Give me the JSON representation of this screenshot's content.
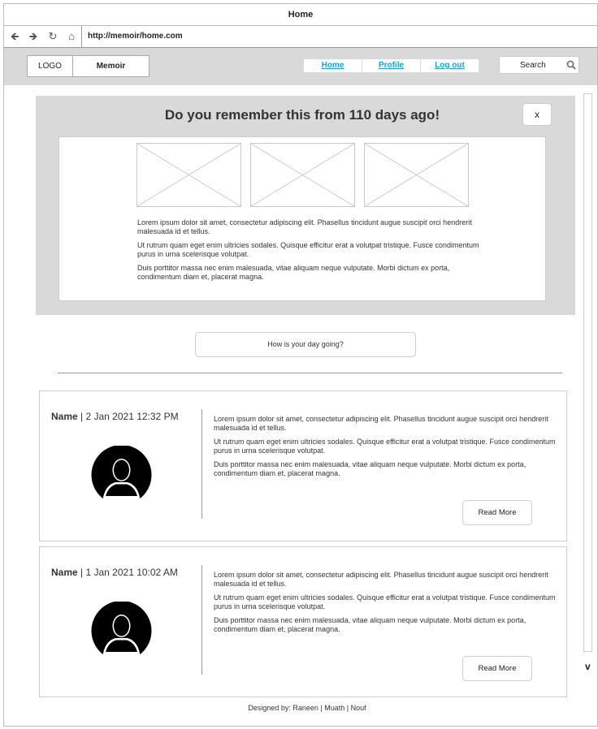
{
  "window": {
    "title": "Home"
  },
  "address": {
    "url": "http://memoir/home.com"
  },
  "header": {
    "logo": "LOGO",
    "brand": "Memoir",
    "nav": [
      {
        "label": "Home"
      },
      {
        "label": "Profile"
      },
      {
        "label": "Log out"
      }
    ],
    "search_label": "Search"
  },
  "memory": {
    "title": "Do you remember this from 110 days ago!",
    "close_label": "x",
    "paragraphs": [
      "Lorem ipsum dolor sit amet, consectetur adipiscing elit. Phasellus tincidunt augue suscipit orci hendrerit malesuada id et tellus.",
      "Ut rutrum quam eget enim ultricies sodales. Quisque efficitur erat a volutpat tristique. Fusce condimentum purus in urna scelerisque volutpat.",
      "Duis porttitor massa nec enim malesuada, vitae aliquam neque vulputate. Morbi dictum ex porta, condimentum diam et, placerat magna."
    ]
  },
  "prompt": {
    "label": "How is your day going?"
  },
  "posts": [
    {
      "name": "Name",
      "sep": " | ",
      "date": "2 Jan 2021 12:32 PM",
      "paragraphs": [
        "Lorem ipsum dolor sit amet, consectetur adipiscing elit. Phasellus tincidunt augue suscipit orci hendrerit malesuada id et tellus.",
        "Ut rutrum quam eget enim ultricies sodales. Quisque efficitur erat a volutpat tristique. Fusce condimentum purus in urna scelerisque volutpat.",
        "Duis porttitor massa nec enim malesuada, vitae aliquam neque vulputate. Morbi dictum ex porta, condimentum diam et, placerat magna."
      ],
      "read_more": "Read More"
    },
    {
      "name": "Name",
      "sep": " | ",
      "date": "1 Jan 2021 10:02 AM",
      "paragraphs": [
        "Lorem ipsum dolor sit amet, consectetur adipiscing elit. Phasellus tincidunt augue suscipit orci hendrerit malesuada id et tellus.",
        "Ut rutrum quam eget enim ultricies sodales. Quisque efficitur erat a volutpat tristique. Fusce condimentum purus in urna scelerisque volutpat.",
        "Duis porttitor massa nec enim malesuada, vitae aliquam neque vulputate. Morbi dictum ex porta, condimentum diam et, placerat magna."
      ],
      "read_more": "Read More"
    }
  ],
  "footer": {
    "text": "Designed by: Raneen | Muath | Nouf"
  },
  "scroll": {
    "down_label": "v"
  },
  "icons": {
    "back": "arrow-left-icon",
    "forward": "arrow-right-icon",
    "reload": "reload-icon",
    "home": "home-icon",
    "search": "search-icon",
    "avatar": "user-avatar-icon"
  }
}
